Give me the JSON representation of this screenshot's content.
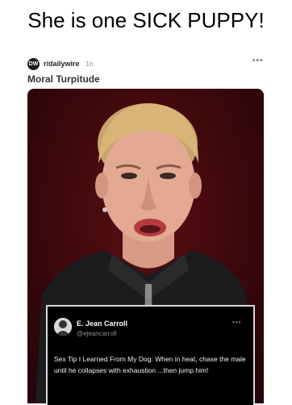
{
  "caption": "She is one SICK PUPPY!",
  "post": {
    "logo_text": "DW",
    "subreddit": "r/dailywire",
    "time": "1h",
    "more": "•••",
    "title": "Moral Turpitude"
  },
  "tweet": {
    "name": "E. Jean Carroll",
    "handle": "@ejeancarroll",
    "more": "•••",
    "text": "Sex Tip I Learned From My Dog: When in heat, chase the male until he collapses with exhaustion ...then jump him!"
  },
  "colors": {
    "media_background": "#4a0a0e",
    "tweet_background": "#000000"
  }
}
